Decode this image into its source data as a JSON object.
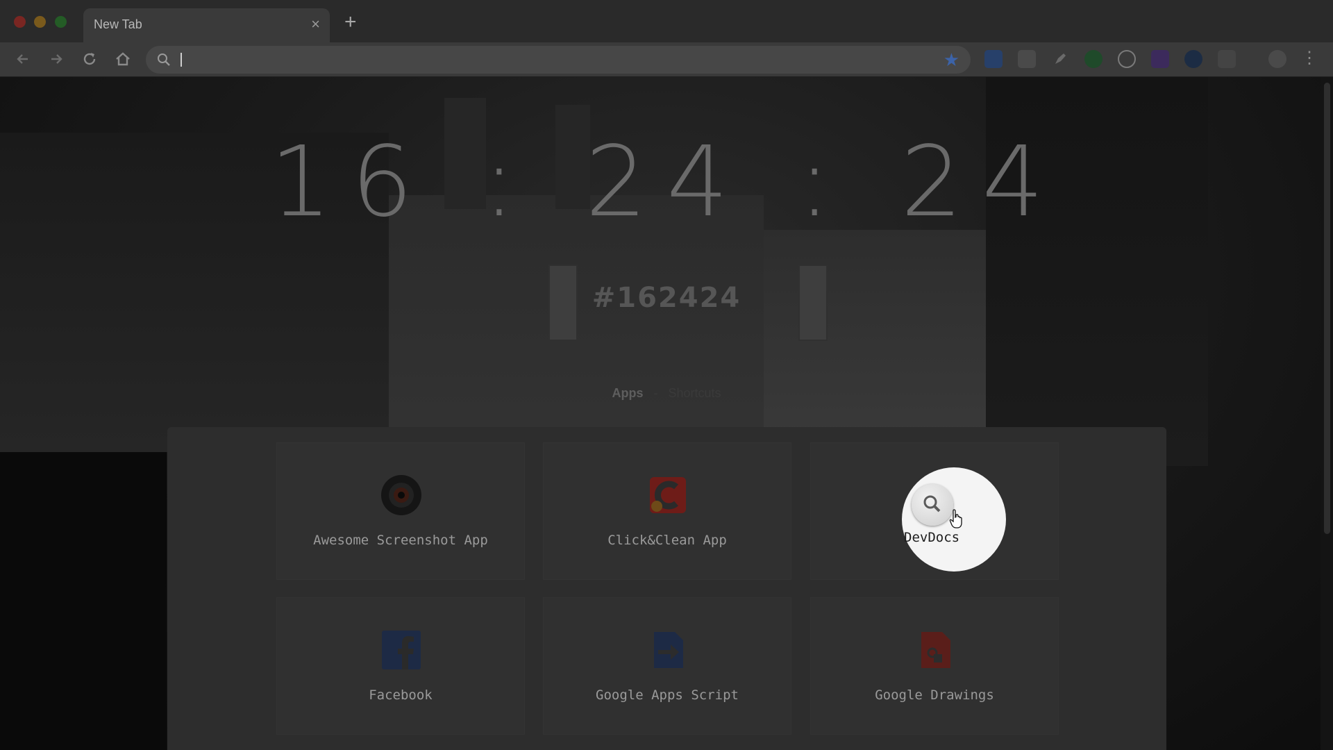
{
  "browser": {
    "tab_title": "New Tab",
    "tab_close": "×",
    "new_tab": "+",
    "omnibox_value": ""
  },
  "clock": {
    "time": "16 : 24 : 24",
    "hex": "#162424"
  },
  "switcher": {
    "apps": "Apps",
    "separator": "-",
    "shortcuts": "Shortcuts"
  },
  "apps": [
    {
      "label": "Awesome Screenshot App",
      "icon": "camera-lens-icon"
    },
    {
      "label": "Click&Clean App",
      "icon": "click-clean-icon"
    },
    {
      "label": "DevDocs",
      "icon": "search-magnifier-icon"
    },
    {
      "label": "Facebook",
      "icon": "facebook-icon"
    },
    {
      "label": "Google Apps Script",
      "icon": "apps-script-icon"
    },
    {
      "label": "Google Drawings",
      "icon": "drawings-icon"
    }
  ],
  "colors": {
    "accent_star": "#3c63a8",
    "hex_code": "#162424"
  }
}
